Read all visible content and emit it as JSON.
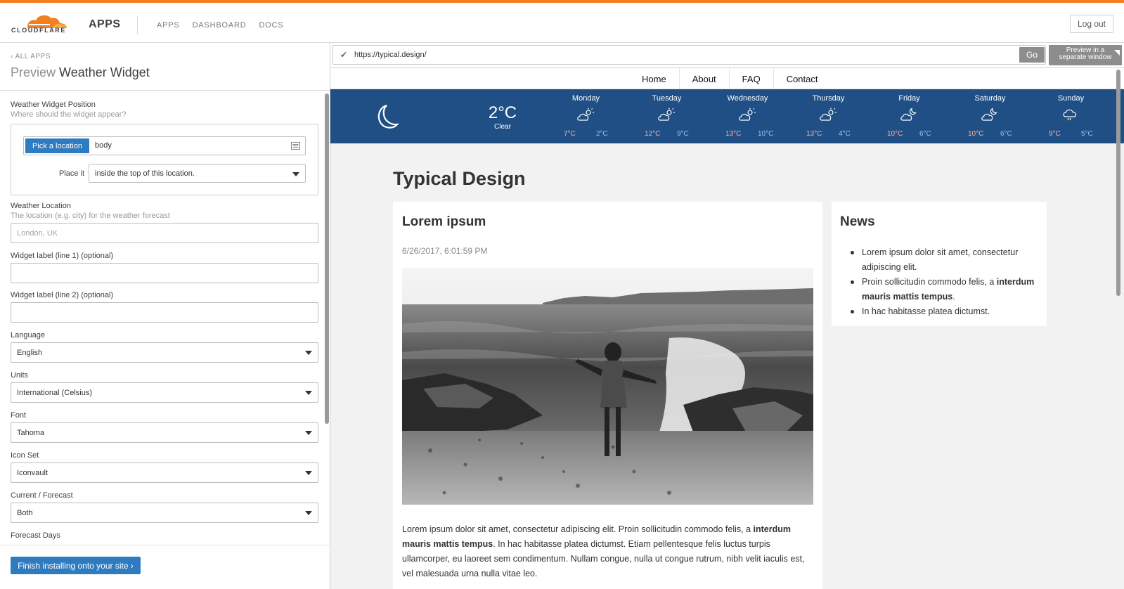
{
  "header": {
    "logo_text": "CLOUDFLARE",
    "app_title": "APPS",
    "nav": [
      "APPS",
      "DASHBOARD",
      "DOCS"
    ],
    "logout_label": "Log out",
    "accent_color": "#f38020"
  },
  "left_panel": {
    "back_link": "ALL APPS",
    "title_prefix": "Preview",
    "title_main": "Weather Widget",
    "position": {
      "label": "Weather Widget Position",
      "help": "Where should the widget appear?",
      "pick_button": "Pick a location",
      "location_value": "body",
      "place_label": "Place it",
      "place_value": "inside the top of this location."
    },
    "weather_location": {
      "label": "Weather Location",
      "help": "The location (e.g. city) for the weather forecast",
      "placeholder": "London, UK"
    },
    "label_line1": {
      "label": "Widget label (line 1) (optional)",
      "value": ""
    },
    "label_line2": {
      "label": "Widget label (line 2) (optional)",
      "value": ""
    },
    "language": {
      "label": "Language",
      "value": "English"
    },
    "units": {
      "label": "Units",
      "value": "International (Celsius)"
    },
    "font": {
      "label": "Font",
      "value": "Tahoma"
    },
    "icon_set": {
      "label": "Icon Set",
      "value": "Iconvault"
    },
    "current_forecast": {
      "label": "Current / Forecast",
      "value": "Both"
    },
    "forecast_days": {
      "label": "Forecast Days"
    },
    "finish_button": "Finish installing onto your site ›",
    "button_color": "#2f7bbf"
  },
  "preview": {
    "url": "https://typical.design/",
    "go_label": "Go",
    "separate_window_label": "Preview in a separate window",
    "site_nav": [
      "Home",
      "About",
      "FAQ",
      "Contact"
    ],
    "weather": {
      "current_temp": "2°C",
      "current_condition": "Clear",
      "current_icon": "moon-icon",
      "bg_color": "#1f4f84",
      "days": [
        {
          "name": "Monday",
          "icon": "partly-cloudy-day-icon",
          "high": "7°C",
          "low": "2°C"
        },
        {
          "name": "Tuesday",
          "icon": "partly-cloudy-day-icon",
          "high": "12°C",
          "low": "9°C"
        },
        {
          "name": "Wednesday",
          "icon": "partly-cloudy-day-icon",
          "high": "13°C",
          "low": "10°C"
        },
        {
          "name": "Thursday",
          "icon": "partly-cloudy-day-icon",
          "high": "13°C",
          "low": "4°C"
        },
        {
          "name": "Friday",
          "icon": "partly-cloudy-night-icon",
          "high": "10°C",
          "low": "6°C"
        },
        {
          "name": "Saturday",
          "icon": "partly-cloudy-night-icon",
          "high": "10°C",
          "low": "6°C"
        },
        {
          "name": "Sunday",
          "icon": "rain-cloud-icon",
          "high": "9°C",
          "low": "5°C"
        }
      ]
    },
    "site_title": "Typical Design",
    "main_card": {
      "title": "Lorem ipsum",
      "date": "6/26/2017, 6:01:59 PM",
      "body_1": "Lorem ipsum dolor sit amet, consectetur adipiscing elit. Proin sollicitudin commodo felis, a ",
      "body_bold": "interdum mauris mattis tempus",
      "body_2": ". In hac habitasse platea dictumst. Etiam pellentesque felis luctus turpis ullamcorper, eu laoreet sem condimentum. Nullam congue, nulla ut congue rutrum, nibh velit iaculis est, vel malesuada urna nulla vitae leo."
    },
    "news_card": {
      "title": "News",
      "item1": "Lorem ipsum dolor sit amet, consectetur adipiscing elit.",
      "item2_text": "Proin sollicitudin commodo felis, a ",
      "item2_bold": "interdum mauris mattis tempus",
      "item2_end": ".",
      "item3": "In hac habitasse platea dictumst."
    }
  }
}
